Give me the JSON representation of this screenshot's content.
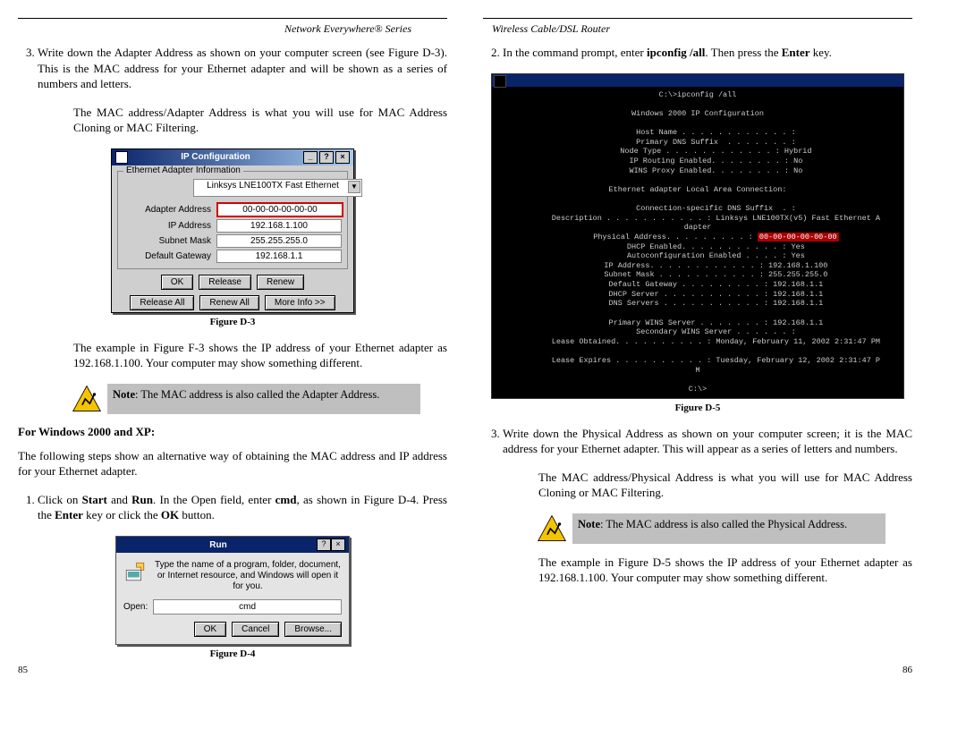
{
  "headers": {
    "left": "Network Everywhere® Series",
    "right": "Wireless Cable/DSL Router"
  },
  "left": {
    "step3": "Write down the Adapter Address as shown on your computer screen (see Figure D-3). This is the MAC address for your Ethernet adapter and will be shown as a series of numbers and letters.",
    "para_mac": "The MAC address/Adapter Address is what you will use for MAC Address Cloning or MAC Filtering.",
    "fig3": {
      "title": "IP Configuration",
      "group": "Ethernet Adapter Information",
      "combo": "Linksys LNE100TX Fast Ethernet",
      "rows": {
        "adapter_lbl": "Adapter Address",
        "adapter_val": "00-00-00-00-00-00",
        "ip_lbl": "IP Address",
        "ip_val": "192.168.1.100",
        "mask_lbl": "Subnet Mask",
        "mask_val": "255.255.255.0",
        "gw_lbl": "Default Gateway",
        "gw_val": "192.168.1.1"
      },
      "btns": {
        "ok": "OK",
        "release": "Release",
        "renew": "Renew",
        "release_all": "Release All",
        "renew_all": "Renew All",
        "more": "More Info >>"
      },
      "caption": "Figure D-3"
    },
    "para_example": "The example in Figure F-3 shows the IP address of your Ethernet adapter as 192.168.1.100. Your computer may show something different.",
    "note_prefix": "Note",
    "note": ": The MAC address is also called the Adapter Address.",
    "section_head": "For Windows 2000 and XP:",
    "para_alt": "The following steps show an alternative way of obtaining the MAC address and IP address for your Ethernet adapter.",
    "step1_a": "Click on ",
    "step1_b": " and ",
    "step1_c": ". In the Open field, enter ",
    "step1_d": ", as shown in Figure D-4. Press the ",
    "step1_e": " key or click the ",
    "step1_f": " button.",
    "b_start": "Start",
    "b_run": "Run",
    "b_cmd": "cmd",
    "b_enter": "Enter",
    "b_ok": "OK",
    "fig4": {
      "title": "Run",
      "desc": "Type the name of a program, folder, document, or Internet resource, and Windows will open it for you.",
      "label": "Open:",
      "value": "cmd",
      "btns": {
        "ok": "OK",
        "cancel": "Cancel",
        "browse": "Browse..."
      },
      "caption": "Figure D-4"
    },
    "page_num": "85"
  },
  "right": {
    "step2_a": "In the command prompt, enter ",
    "step2_b": ". Then press the ",
    "step2_c": " key.",
    "b_ipconfig": "ipconfig /all",
    "b_enter": "Enter",
    "fig5": {
      "line1": "C:\\>ipconfig /all",
      "line2": "Windows 2000 IP Configuration",
      "host": "        Host Name . . . . . . . . . . . . :",
      "dns1": "        Primary DNS Suffix  . . . . . . . :",
      "node": "        Node Type . . . . . . . . . . . . : Hybrid",
      "rout": "        IP Routing Enabled. . . . . . . . : No",
      "wins": "        WINS Proxy Enabled. . . . . . . . : No",
      "adapter": "Ethernet adapter Local Area Connection:",
      "csuf": "        Connection-specific DNS Suffix  . :",
      "desc": "        Description . . . . . . . . . . . : Linksys LNE100TX(v5) Fast Ethernet A",
      "dapter": "dapter",
      "phys_lbl": "        Physical Address. . . . . . . . . : ",
      "phys_val": "00-00-00-00-00-00",
      "dhcp": "        DHCP Enabled. . . . . . . . . . . : Yes",
      "auto": "        Autoconfiguration Enabled . . . . : Yes",
      "ip": "        IP Address. . . . . . . . . . . . : 192.168.1.100",
      "mask": "        Subnet Mask . . . . . . . . . . . : 255.255.255.0",
      "gw": "        Default Gateway . . . . . . . . . : 192.168.1.1",
      "dhcps": "        DHCP Server . . . . . . . . . . . : 192.168.1.1",
      "dnss": "        DNS Servers . . . . . . . . . . . : 192.168.1.1",
      "pwins": "        Primary WINS Server . . . . . . . : 192.168.1.1",
      "swins": "        Secondary WINS Server . . . . . . :",
      "lease": "        Lease Obtained. . . . . . . . . . : Monday, February 11, 2002 2:31:47 PM",
      "blank": "",
      "leaseex": "        Lease Expires . . . . . . . . . . : Tuesday, February 12, 2002 2:31:47 P",
      "m": "M",
      "prompt": "C:\\>",
      "caption": "Figure D-5"
    },
    "step3": "Write down the Physical Address as shown on your computer screen; it is the MAC address for your Ethernet adapter. This will appear as a series of letters and numbers.",
    "para_mac": "The MAC address/Physical Address is what you will use for MAC Address Cloning or MAC Filtering.",
    "note_prefix": "Note",
    "note": ": The MAC address is also called the Physical Address.",
    "para_example": "The example in Figure D-5 shows the IP address of your Ethernet adapter as 192.168.1.100. Your computer may show something different.",
    "page_num": "86"
  }
}
